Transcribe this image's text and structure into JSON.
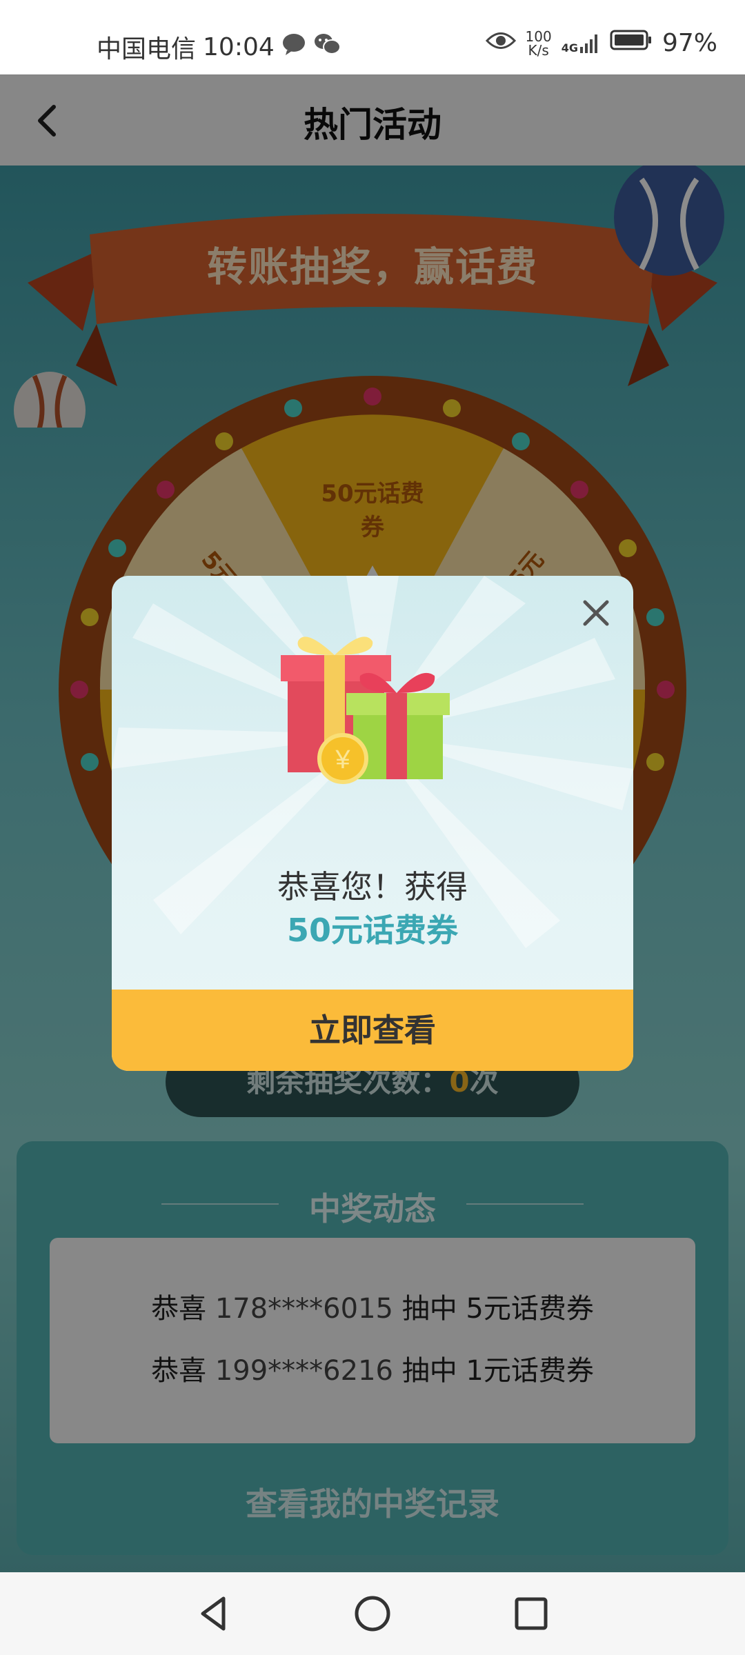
{
  "status_bar": {
    "carrier": "中国电信",
    "time": "10:04",
    "net_speed_value": "100",
    "net_speed_unit": "K/s",
    "signal_label": "4G",
    "battery": "97%",
    "battery_level": 0.97
  },
  "header": {
    "title": "热门活动",
    "back_icon": "chevron-left-icon"
  },
  "activity": {
    "banner_title": "转账抽奖，赢话费",
    "wheel_segments": [
      "50元话费券",
      "5元",
      "5元"
    ],
    "remaining_label": "剩余抽奖次数：",
    "remaining_count": "0",
    "remaining_suffix": "次"
  },
  "winners": {
    "title": "中奖动态",
    "rows": [
      {
        "prefix": "恭喜",
        "phone": "178****6015",
        "action": "抽中",
        "prize": "5元话费券"
      },
      {
        "prefix": "恭喜",
        "phone": "199****6216",
        "action": "抽中",
        "prize": "1元话费券"
      }
    ],
    "my_records_link": "查看我的中奖记录"
  },
  "modal": {
    "close_icon": "close-icon",
    "gift_icon": "gift-icon",
    "congrats": "恭喜您！获得",
    "prize": "50元话费券",
    "button": "立即查看"
  },
  "navbar": {
    "back_icon": "triangle-back-icon",
    "home_icon": "circle-home-icon",
    "recents_icon": "square-recents-icon"
  },
  "colors": {
    "accent_teal": "#3ba7b3",
    "button_yellow": "#fbbb3a",
    "banner_red": "#c0522a",
    "wheel_brown": "#a34a16"
  }
}
